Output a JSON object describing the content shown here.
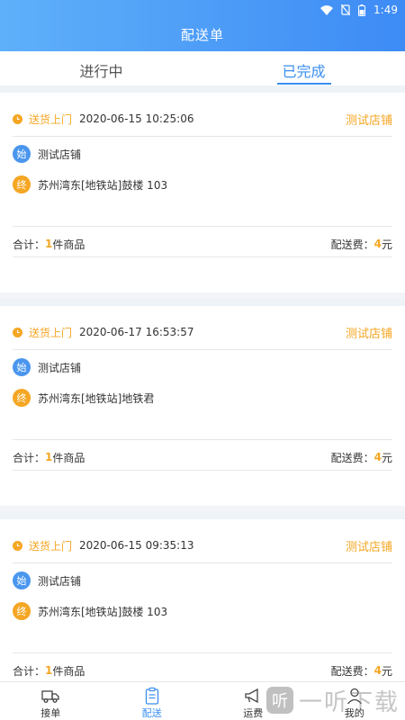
{
  "status": {
    "time": "1:49"
  },
  "header": {
    "title": "配送单"
  },
  "tabs": [
    {
      "label": "进行中"
    },
    {
      "label": "已完成"
    }
  ],
  "orders": [
    {
      "mode": "送货上门",
      "datetime": "2020-06-15 10:25:06",
      "store": "测试店铺",
      "start_badge": "始",
      "start": "测试店铺",
      "end_badge": "终",
      "end": "苏州湾东[地铁站]鼓楼 103",
      "total_label": "合计：",
      "count": "1",
      "count_unit": "件商品",
      "fee_label": "配送费：",
      "fee": "4",
      "fee_unit": "元"
    },
    {
      "mode": "送货上门",
      "datetime": "2020-06-17 16:53:57",
      "store": "测试店铺",
      "start_badge": "始",
      "start": "测试店铺",
      "end_badge": "终",
      "end": "苏州湾东[地铁站]地铁君",
      "total_label": "合计：",
      "count": "1",
      "count_unit": "件商品",
      "fee_label": "配送费：",
      "fee": "4",
      "fee_unit": "元"
    },
    {
      "mode": "送货上门",
      "datetime": "2020-06-15 09:35:13",
      "store": "测试店铺",
      "start_badge": "始",
      "start": "测试店铺",
      "end_badge": "终",
      "end": "苏州湾东[地铁站]鼓楼 103",
      "total_label": "合计：",
      "count": "1",
      "count_unit": "件商品",
      "fee_label": "配送费：",
      "fee": "4",
      "fee_unit": "元"
    }
  ],
  "nav": [
    {
      "label": "接单"
    },
    {
      "label": "配送"
    },
    {
      "label": "运费"
    },
    {
      "label": "我的"
    }
  ],
  "watermark": {
    "icon": "听",
    "text": "一听下载"
  },
  "colors": {
    "accent": "#3a8ef0",
    "orange": "#f5a623",
    "header_start": "#5fb0fa",
    "header_end": "#3d8bf5"
  }
}
